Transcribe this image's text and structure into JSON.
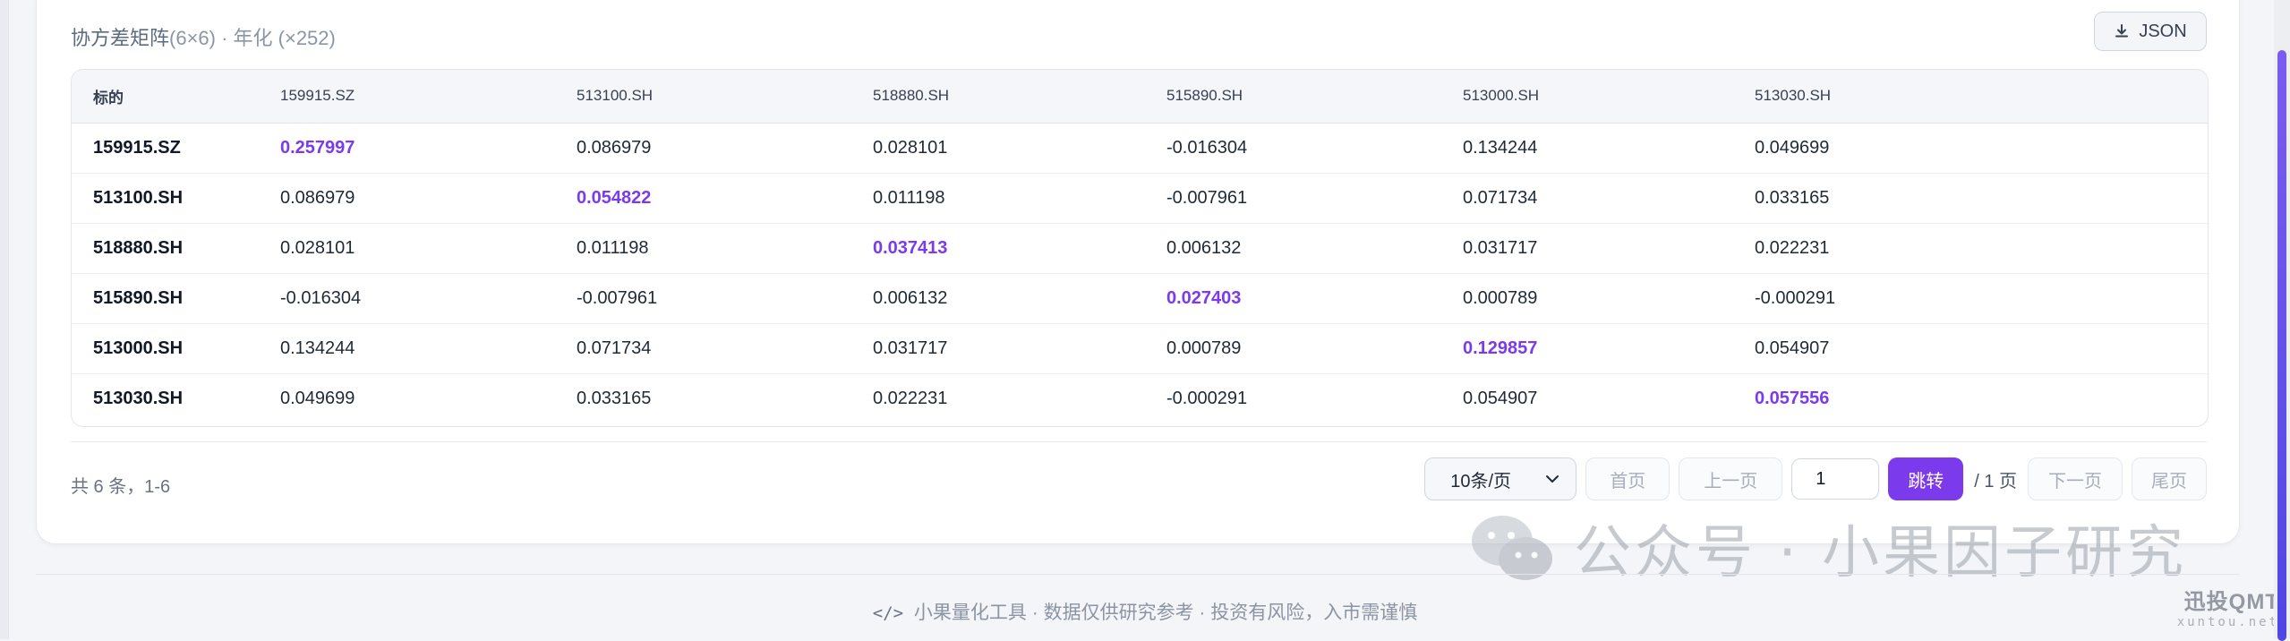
{
  "header": {
    "title": "协方差矩阵",
    "subtitle": " (6×6) · 年化 (×252)",
    "json_button_label": "JSON",
    "json_icon": "download-icon"
  },
  "table": {
    "corner_label": "标的",
    "columns": [
      "159915.SZ",
      "513100.SH",
      "518880.SH",
      "515890.SH",
      "513000.SH",
      "513030.SH"
    ],
    "rows": [
      {
        "label": "159915.SZ",
        "values": [
          "0.257997",
          "0.086979",
          "0.028101",
          "-0.016304",
          "0.134244",
          "0.049699"
        ]
      },
      {
        "label": "513100.SH",
        "values": [
          "0.086979",
          "0.054822",
          "0.011198",
          "-0.007961",
          "0.071734",
          "0.033165"
        ]
      },
      {
        "label": "518880.SH",
        "values": [
          "0.028101",
          "0.011198",
          "0.037413",
          "0.006132",
          "0.031717",
          "0.022231"
        ]
      },
      {
        "label": "515890.SH",
        "values": [
          "-0.016304",
          "-0.007961",
          "0.006132",
          "0.027403",
          "0.000789",
          "-0.000291"
        ]
      },
      {
        "label": "513000.SH",
        "values": [
          "0.134244",
          "0.071734",
          "0.031717",
          "0.000789",
          "0.129857",
          "0.054907"
        ]
      },
      {
        "label": "513030.SH",
        "values": [
          "0.049699",
          "0.033165",
          "0.022231",
          "-0.000291",
          "0.054907",
          "0.057556"
        ]
      }
    ],
    "diagonal_color": "#7c3aed"
  },
  "pagination": {
    "total_text": "共 6 条，1-6",
    "page_size": "10条/页",
    "first": "首页",
    "prev": "上一页",
    "page_input": "1",
    "go": "跳转",
    "pages": "/ 1 页",
    "next": "下一页",
    "last": "尾页"
  },
  "footer": {
    "code_icon": "</>",
    "text": "小果量化工具 · 数据仅供研究参考 · 投资有风险，入市需谨慎"
  },
  "watermark": {
    "main": "公众号 · 小果因子研究",
    "brand": "迅投QMT",
    "domain": "xuntou.net"
  },
  "colors": {
    "accent": "#7c3aed",
    "background": "#f4f5f8"
  }
}
